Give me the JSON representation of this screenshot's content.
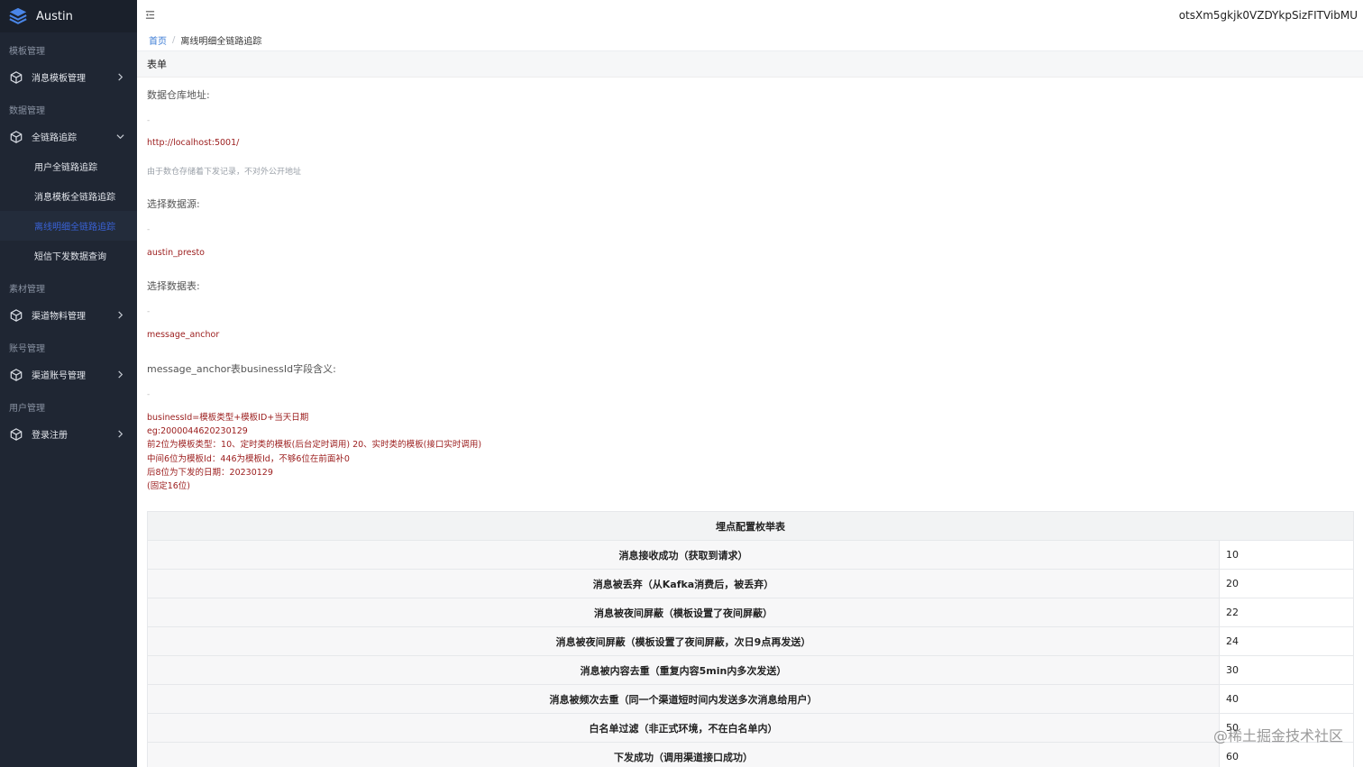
{
  "app": {
    "logo_text": "Austin",
    "user_id": "otsXm5gkjk0VZDYkpSizFITVibMU"
  },
  "sidebar": {
    "groups": [
      {
        "title": "模板管理",
        "items": [
          {
            "label": "消息模板管理",
            "icon": "cube-icon",
            "expanded": false
          }
        ]
      },
      {
        "title": "数据管理",
        "items": [
          {
            "label": "全链路追踪",
            "icon": "cube-icon",
            "expanded": true,
            "children": [
              "用户全链路追踪",
              "消息模板全链路追踪",
              "离线明细全链路追踪",
              "短信下发数据查询"
            ],
            "active_child": "离线明细全链路追踪"
          }
        ]
      },
      {
        "title": "素材管理",
        "items": [
          {
            "label": "渠道物料管理",
            "icon": "cube-icon",
            "expanded": false
          }
        ]
      },
      {
        "title": "账号管理",
        "items": [
          {
            "label": "渠道账号管理",
            "icon": "cube-icon",
            "expanded": false
          }
        ]
      },
      {
        "title": "用户管理",
        "items": [
          {
            "label": "登录注册",
            "icon": "cube-icon",
            "expanded": false
          }
        ]
      }
    ]
  },
  "breadcrumb": {
    "home": "首页",
    "separator": "/",
    "current": "离线明细全链路追踪"
  },
  "form": {
    "title": "表单",
    "warehouse": {
      "label": "数据仓库地址:",
      "dash": "-",
      "value": "http://localhost:5001/",
      "hint": "由于数仓存储着下发记录，不对外公开地址"
    },
    "datasource": {
      "label": "选择数据源:",
      "dash": "-",
      "value": "austin_presto"
    },
    "datatable": {
      "label": "选择数据表:",
      "dash": "-",
      "value": "message_anchor"
    },
    "business_id": {
      "label": "message_anchor表businessId字段含义:",
      "dash": "-",
      "lines": [
        "businessId=模板类型+模板ID+当天日期",
        "eg:2000044620230129",
        "前2位为模板类型：10、定时类的模板(后台定时调用) 20、实时类的模板(接口实时调用)",
        "中间6位为模板Id：446为模板Id，不够6位在前面补0",
        "后8位为下发的日期：20230129",
        "(固定16位)"
      ]
    }
  },
  "enum_table": {
    "title": "埋点配置枚举表",
    "rows": [
      {
        "desc": "消息接收成功（获取到请求）",
        "code": "10"
      },
      {
        "desc": "消息被丢弃（从Kafka消费后，被丢弃）",
        "code": "20"
      },
      {
        "desc": "消息被夜间屏蔽（模板设置了夜间屏蔽）",
        "code": "22"
      },
      {
        "desc": "消息被夜间屏蔽（模板设置了夜间屏蔽，次日9点再发送）",
        "code": "24"
      },
      {
        "desc": "消息被内容去重（重复内容5min内多次发送）",
        "code": "30"
      },
      {
        "desc": "消息被频次去重（同一个渠道短时间内发送多次消息给用户）",
        "code": "40"
      },
      {
        "desc": "白名单过滤（非正式环境，不在白名单内）",
        "code": "50"
      },
      {
        "desc": "下发成功（调用渠道接口成功）",
        "code": "60"
      }
    ]
  },
  "watermark": "@稀土掘金技术社区",
  "colors": {
    "sidebar_bg": "#1f2633",
    "active_text": "#3a63d8",
    "value_red": "#9b1c1c",
    "link_blue": "#3a7bd5"
  }
}
